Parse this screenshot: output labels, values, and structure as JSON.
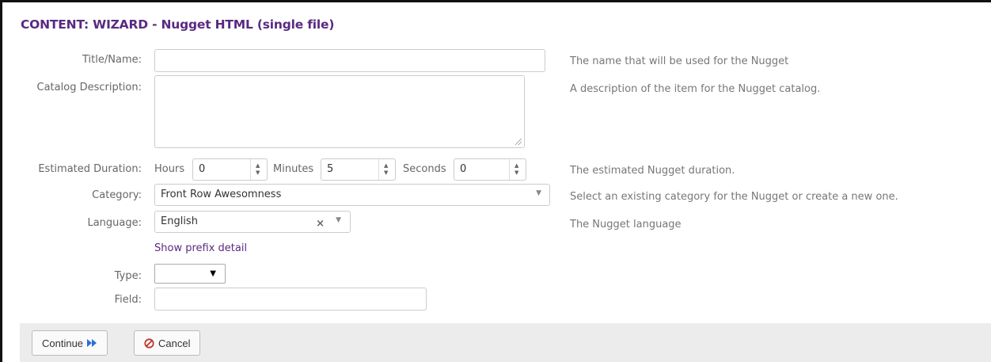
{
  "title": "CONTENT: WIZARD - Nugget HTML (single file)",
  "fields": {
    "title_name": {
      "label": "Title/Name:",
      "value": "",
      "help": "The name that will be used for the Nugget"
    },
    "catalog_description": {
      "label": "Catalog Description:",
      "value": "",
      "help": "A description of the item for the Nugget catalog."
    },
    "estimated_duration": {
      "label": "Estimated Duration:",
      "hours_label": "Hours",
      "hours": "0",
      "minutes_label": "Minutes",
      "minutes": "5",
      "seconds_label": "Seconds",
      "seconds": "0",
      "help": "The estimated Nugget duration."
    },
    "category": {
      "label": "Category:",
      "value": "Front Row Awesomness",
      "help": "Select an existing category for the Nugget or create a new one."
    },
    "language": {
      "label": "Language:",
      "value": "English",
      "help": "The Nugget language"
    },
    "show_prefix_link": "Show prefix detail",
    "type": {
      "label": "Type:",
      "value": ""
    },
    "field": {
      "label": "Field:",
      "value": ""
    }
  },
  "buttons": {
    "continue": "Continue",
    "cancel": "Cancel"
  },
  "colors": {
    "accent": "#5a2a82",
    "continue_icon": "#2a6fd6",
    "cancel_icon": "#c0392b",
    "footer_bg": "#ececec"
  },
  "icons": {
    "continue": "fast-forward-icon",
    "cancel": "ban-icon",
    "spinner": "spinner-arrows-icon",
    "dropdown": "caret-down-icon",
    "clear": "clear-x-icon"
  }
}
